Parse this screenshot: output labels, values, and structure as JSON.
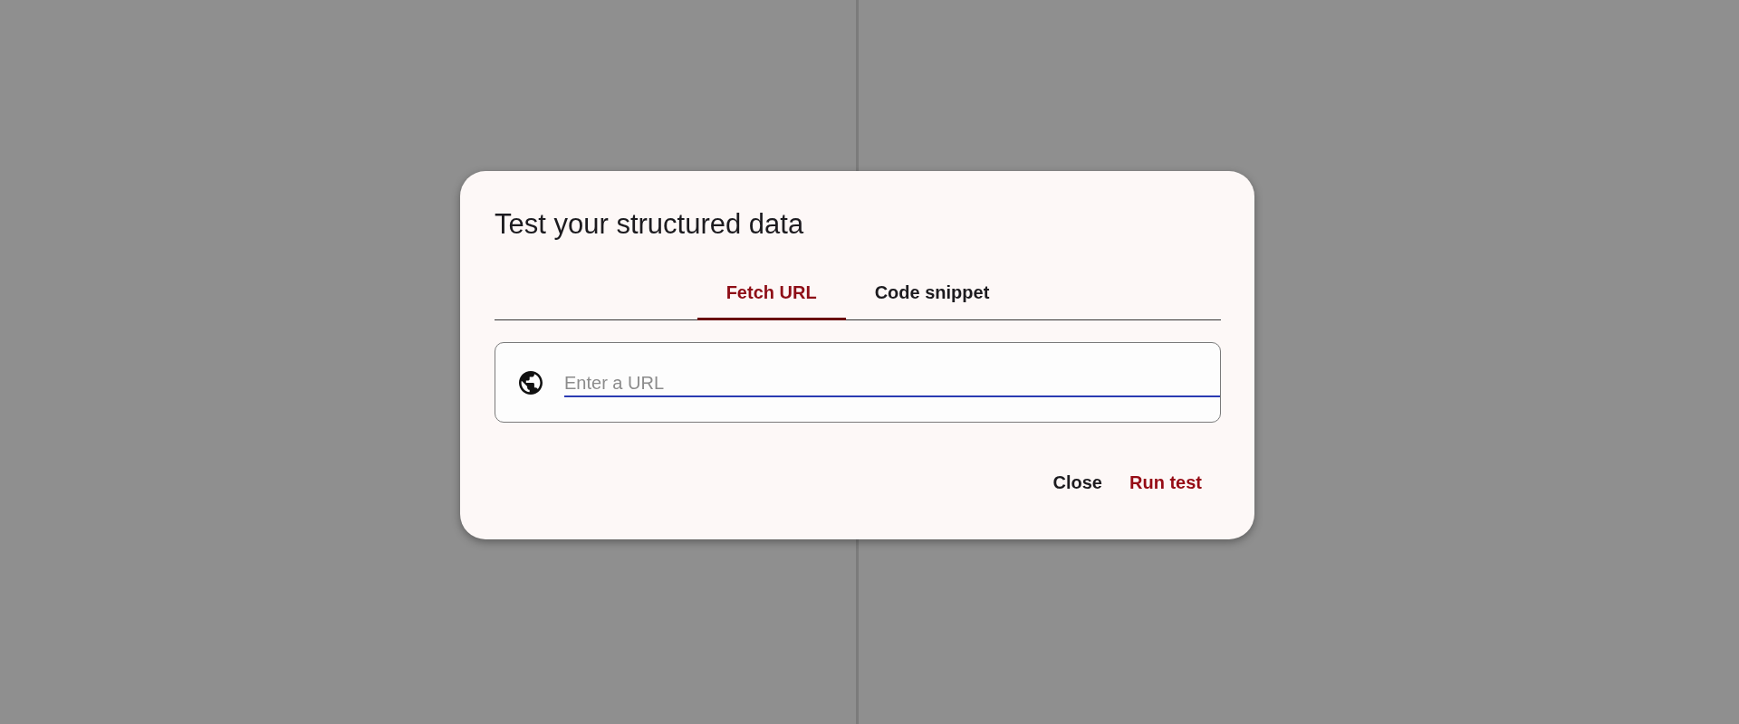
{
  "dialog": {
    "title": "Test your structured data",
    "tabs": [
      {
        "label": "Fetch URL",
        "selected": true
      },
      {
        "label": "Code snippet",
        "selected": false
      }
    ],
    "url_field": {
      "placeholder": "Enter a URL"
    },
    "buttons": [
      {
        "label": "Close",
        "kind": "dismiss"
      },
      {
        "label": "Run test",
        "kind": "confirm"
      }
    ]
  }
}
